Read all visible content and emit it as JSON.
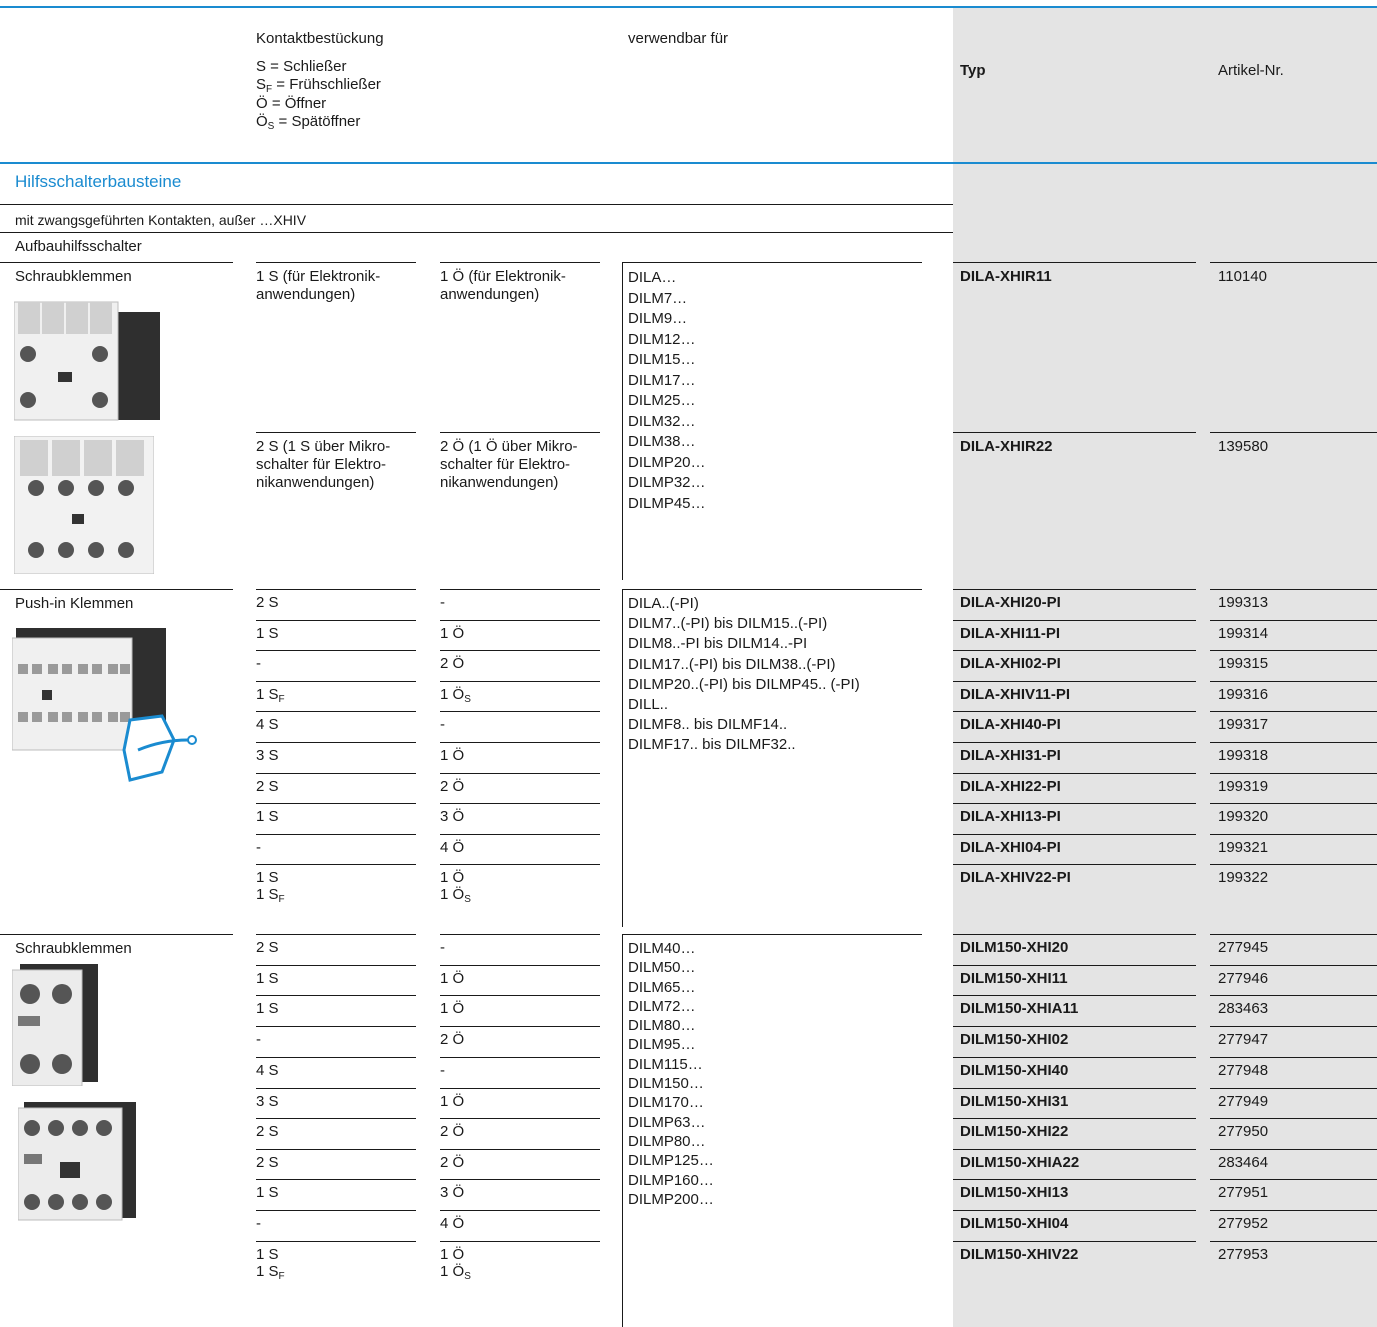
{
  "header": {
    "contacts_title": "Kontaktbestückung",
    "legend": [
      {
        "sym": "S",
        "sub": "",
        "text": " = Schließer"
      },
      {
        "sym": "S",
        "sub": "F",
        "text": " = Frühschließer"
      },
      {
        "sym": "Ö",
        "sub": "",
        "text": " = Öffner"
      },
      {
        "sym": "Ö",
        "sub": "S",
        "text": " = Spätöffner"
      }
    ],
    "usable_for": "verwendbar für",
    "type": "Typ",
    "article": "Artikel-Nr."
  },
  "section_title": "Hilfsschalterbausteine",
  "subtitle": "mit zwangsgeführten Kontakten, außer …XHIV",
  "group_title": "Aufbauhilfsschalter",
  "groups": {
    "screw1": {
      "label": "Schraubklemmen",
      "rows": [
        {
          "s": "1 S (für Elektronik-\nanwendungen)",
          "o": "1 Ö (für Elektronik-\nanwendungen)",
          "type": "DILA-XHIR11",
          "art": "110140"
        },
        {
          "s": "2 S (1 S über Mikro-\nschalter für Elektro-\nnikanwendungen)",
          "o": "2 Ö (1 Ö über Mikro-\nschalter für Elektro-\nnikanwendungen)",
          "type": "DILA-XHIR22",
          "art": "139580"
        }
      ],
      "usable": "DILA…\nDILM7…\nDILM9…\nDILM12…\nDILM15…\nDILM17…\nDILM25…\nDILM32…\nDILM38…\nDILMP20…\nDILMP32…\nDILMP45…"
    },
    "pushin": {
      "label": "Push-in Klemmen",
      "usable": "DILA..(-PI)\nDILM7..(-PI) bis DILM15..(-PI)\nDILM8..-PI bis DILM14..-PI\nDILM17..(-PI) bis DILM38..(-PI)\nDILMP20..(-PI) bis DILMP45.. (-PI)\nDILL..\nDILMF8.. bis DILMF14..\nDILMF17.. bis DILMF32..",
      "rows": [
        {
          "s": "2 S",
          "o": "-",
          "type": "DILA-XHI20-PI",
          "art": "199313"
        },
        {
          "s": "1 S",
          "o": "1 Ö",
          "type": "DILA-XHI11-PI",
          "art": "199314"
        },
        {
          "s": "-",
          "o": "2 Ö",
          "type": "DILA-XHI02-PI",
          "art": "199315"
        },
        {
          "s": "1 S",
          "s_sub": "F",
          "o": "1 Ö",
          "o_sub": "S",
          "type": "DILA-XHIV11-PI",
          "art": "199316"
        },
        {
          "s": "4 S",
          "o": "-",
          "type": "DILA-XHI40-PI",
          "art": "199317"
        },
        {
          "s": "3 S",
          "o": "1 Ö",
          "type": "DILA-XHI31-PI",
          "art": "199318"
        },
        {
          "s": "2 S",
          "o": "2 Ö",
          "type": "DILA-XHI22-PI",
          "art": "199319"
        },
        {
          "s": "1 S",
          "o": "3 Ö",
          "type": "DILA-XHI13-PI",
          "art": "199320"
        },
        {
          "s": "-",
          "o": "4 Ö",
          "type": "DILA-XHI04-PI",
          "art": "199321"
        },
        {
          "s": "1 S",
          "s2": "1 S",
          "s2_sub": "F",
          "o": "1 Ö",
          "o2": "1 Ö",
          "o2_sub": "S",
          "type": "DILA-XHIV22-PI",
          "art": "199322"
        }
      ]
    },
    "screw2": {
      "label": "Schraubklemmen",
      "usable": "DILM40…\nDILM50…\nDILM65…\nDILM72…\nDILM80…\nDILM95…\nDILM115…\nDILM150…\nDILM170…\nDILMP63…\nDILMP80…\nDILMP125…\nDILMP160…\nDILMP200…",
      "rows": [
        {
          "s": "2 S",
          "o": "-",
          "type": "DILM150-XHI20",
          "art": "277945"
        },
        {
          "s": "1 S",
          "o": "1 Ö",
          "type": "DILM150-XHI11",
          "art": "277946"
        },
        {
          "s": "1 S",
          "o": "1 Ö",
          "type": "DILM150-XHIA11",
          "art": "283463"
        },
        {
          "s": "-",
          "o": "2 Ö",
          "type": "DILM150-XHI02",
          "art": "277947"
        },
        {
          "s": "4 S",
          "o": "-",
          "type": "DILM150-XHI40",
          "art": "277948"
        },
        {
          "s": "3 S",
          "o": "1 Ö",
          "type": "DILM150-XHI31",
          "art": "277949"
        },
        {
          "s": "2 S",
          "o": "2 Ö",
          "type": "DILM150-XHI22",
          "art": "277950"
        },
        {
          "s": "2 S",
          "o": "2 Ö",
          "type": "DILM150-XHIA22",
          "art": "283464"
        },
        {
          "s": "1 S",
          "o": "3 Ö",
          "type": "DILM150-XHI13",
          "art": "277951"
        },
        {
          "s": "-",
          "o": "4 Ö",
          "type": "DILM150-XHI04",
          "art": "277952"
        },
        {
          "s": "1 S",
          "s2": "1 S",
          "s2_sub": "F",
          "o": "1 Ö",
          "o2": "1 Ö",
          "o2_sub": "S",
          "type": "DILM150-XHIV22",
          "art": "277953"
        }
      ]
    }
  }
}
